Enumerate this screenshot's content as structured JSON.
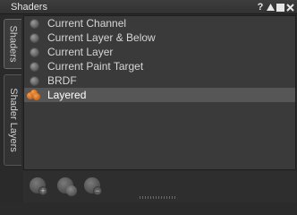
{
  "window": {
    "title": "Shaders",
    "buttons": [
      {
        "name": "help-button",
        "icon": "question-icon",
        "glyph": "?"
      },
      {
        "name": "collapse-button",
        "icon": "triangle-up-icon"
      },
      {
        "name": "popout-button",
        "icon": "square-icon"
      },
      {
        "name": "close-button",
        "icon": "close-icon"
      }
    ]
  },
  "side_tabs": [
    {
      "label": "Shaders",
      "active": true
    },
    {
      "label": "Shader Layers",
      "active": false
    }
  ],
  "shader_list": [
    {
      "label": "Current Channel",
      "icon": "sphere-icon"
    },
    {
      "label": "Current Layer & Below",
      "icon": "sphere-icon"
    },
    {
      "label": "Current Layer",
      "icon": "sphere-icon"
    },
    {
      "label": "Current Paint Target",
      "icon": "sphere-icon"
    },
    {
      "label": "BRDF",
      "icon": "sphere-icon"
    },
    {
      "label": "Layered",
      "icon": "layered-spheres-icon",
      "selected": true
    }
  ],
  "toolbar": [
    {
      "name": "add-shader-button",
      "icon": "add-shader-icon"
    },
    {
      "name": "layer-shader-button",
      "icon": "layered-spheres-icon"
    },
    {
      "name": "remove-shader-button",
      "icon": "remove-shader-icon"
    }
  ],
  "colors": {
    "panel": "#3a3a3a",
    "selected_row": "#565656",
    "accent_orange": "#e07a20"
  }
}
